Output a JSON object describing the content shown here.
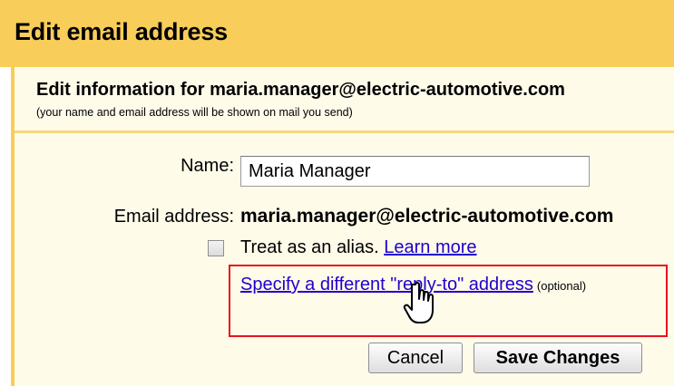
{
  "dialog": {
    "title": "Edit email address",
    "heading": "Edit information for maria.manager@electric-automotive.com",
    "subheading": "(your name and email address will be shown on mail you send)"
  },
  "form": {
    "name_label": "Name:",
    "name_value": "Maria Manager",
    "email_label": "Email address:",
    "email_value": "maria.manager@electric-automotive.com",
    "alias_checkbox": {
      "checked": false,
      "label": "Treat as an alias.",
      "learn_more": "Learn more"
    },
    "reply_to_link": "Specify a different \"reply-to\" address",
    "reply_to_optional": "(optional)"
  },
  "buttons": {
    "cancel": "Cancel",
    "save": "Save Changes"
  },
  "colors": {
    "title_bar": "#f8cd59",
    "background": "#fefbe9",
    "link": "#2200cc",
    "highlight": "#e5131d"
  },
  "icons": {
    "cursor": "hand-pointer-icon"
  }
}
